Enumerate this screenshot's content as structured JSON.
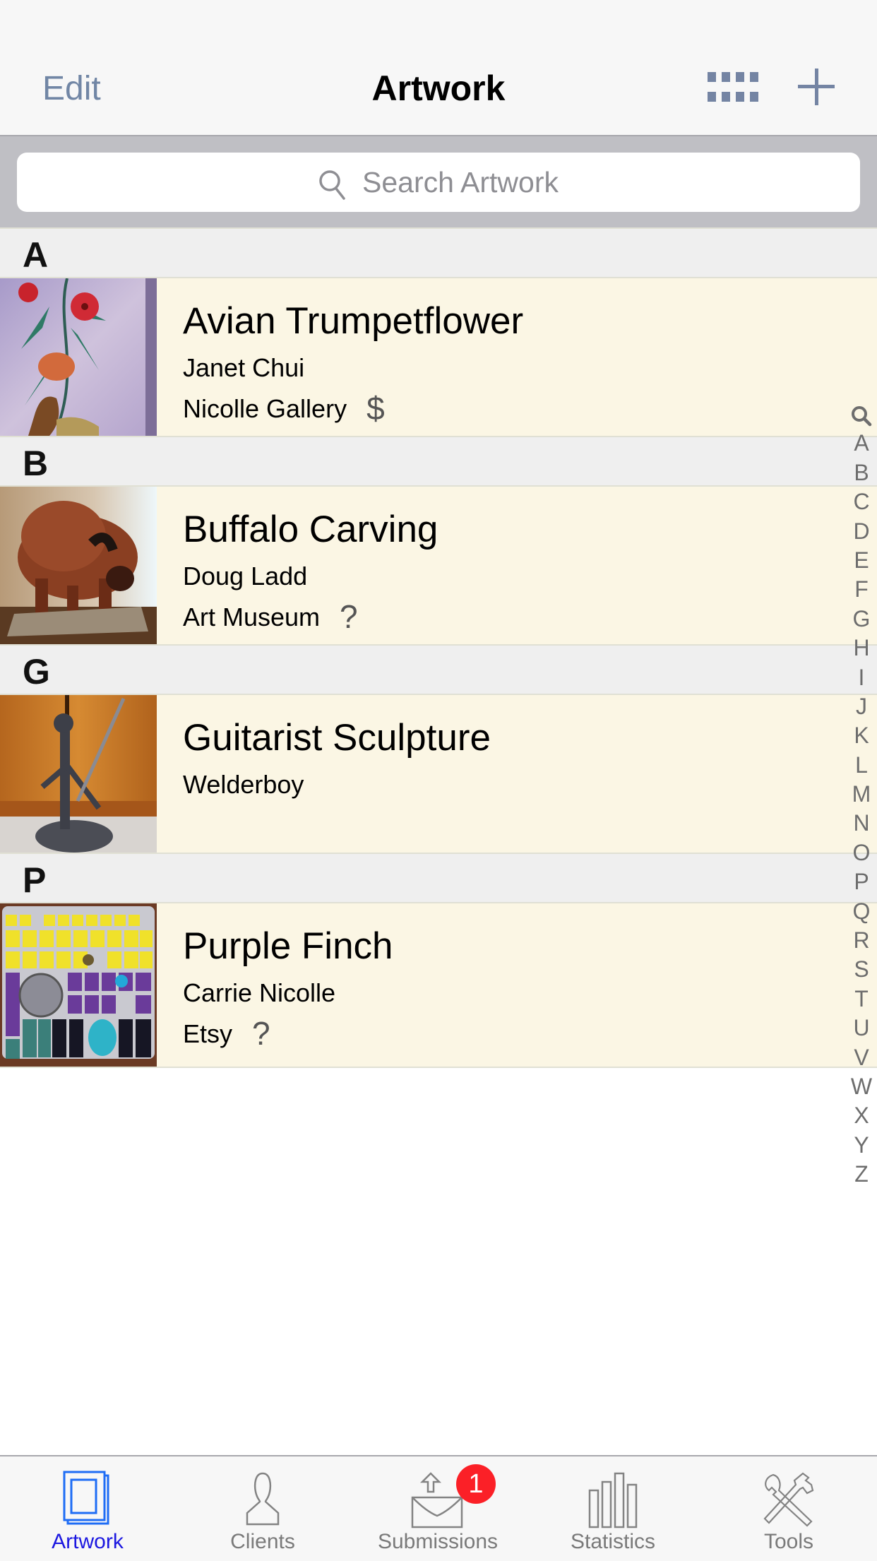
{
  "navbar": {
    "edit_label": "Edit",
    "title": "Artwork",
    "grid_icon": "grid-view-icon",
    "add_icon": "plus-icon"
  },
  "search": {
    "placeholder": "Search Artwork",
    "icon": "search-icon"
  },
  "sections": [
    {
      "letter": "A",
      "items": [
        {
          "title": "Avian Trumpetflower",
          "artist": "Janet Chui",
          "venue": "Nicolle Gallery",
          "status": "$",
          "status_meaning": "sold",
          "thumbnail": "painting of red trumpet flowers on vine"
        }
      ]
    },
    {
      "letter": "B",
      "items": [
        {
          "title": "Buffalo Carving",
          "artist": "Doug Ladd",
          "venue": "Art Museum",
          "status": "?",
          "status_meaning": "unknown",
          "thumbnail": "wooden buffalo carving on rock base"
        }
      ]
    },
    {
      "letter": "G",
      "items": [
        {
          "title": "Guitarist Sculpture",
          "artist": "Welderboy",
          "venue": "",
          "status": "",
          "status_meaning": "",
          "thumbnail": "metal welded guitarist sculpture"
        }
      ]
    },
    {
      "letter": "P",
      "items": [
        {
          "title": "Purple Finch",
          "artist": "Carrie Nicolle",
          "venue": "Etsy",
          "status": "?",
          "status_meaning": "unknown",
          "thumbnail": "yellow and purple mosaic tile with finch"
        }
      ]
    }
  ],
  "index_bar": [
    "search",
    "A",
    "B",
    "C",
    "D",
    "E",
    "F",
    "G",
    "H",
    "I",
    "J",
    "K",
    "L",
    "M",
    "N",
    "O",
    "P",
    "Q",
    "R",
    "S",
    "T",
    "U",
    "V",
    "W",
    "X",
    "Y",
    "Z"
  ],
  "tabbar": {
    "tabs": [
      {
        "label": "Artwork",
        "icon": "artwork-stack-icon",
        "active": true
      },
      {
        "label": "Clients",
        "icon": "person-icon",
        "active": false
      },
      {
        "label": "Submissions",
        "icon": "envelope-upload-icon",
        "active": false,
        "badge": "1"
      },
      {
        "label": "Statistics",
        "icon": "bar-chart-icon",
        "active": false
      },
      {
        "label": "Tools",
        "icon": "tools-icon",
        "active": false
      }
    ]
  },
  "colors": {
    "accent": "#7484a3",
    "active_tab": "#1c18e0",
    "row_bg": "#fbf6e4",
    "section_bg": "#efefef",
    "badge": "#fb2027"
  }
}
